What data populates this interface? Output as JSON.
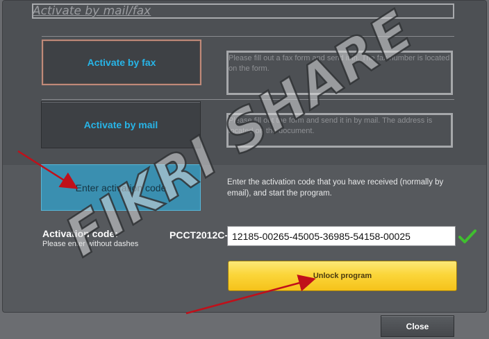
{
  "dialog": {
    "title": "Activate by mail/fax"
  },
  "options": {
    "fax_label": "Activate by fax",
    "fax_desc": "Please fill out a fax form and send it in. The fax number is located on the form.",
    "mail_label": "Activate by mail",
    "mail_desc": "Please fill out the form and send it in by mail. The address is located on the document.",
    "code_label": "Enter activation code",
    "code_desc": "Enter the activation code that you have received (normally by email), and start the program."
  },
  "activation": {
    "label": "Activation code:",
    "sublabel": "Please enter without dashes",
    "prefix": "PCCT2012C-",
    "value": "12185-00265-45005-36985-54158-00025",
    "status_icon": "check-icon",
    "status_color": "#3fbf2f"
  },
  "buttons": {
    "unlock_label": "Unlock program",
    "close_label": "Close"
  },
  "watermark": {
    "text": "FIKRI SHARE"
  },
  "colors": {
    "accent": "#27b5e8",
    "unlock": "#fbd63a",
    "arrow": "#c0101a"
  }
}
